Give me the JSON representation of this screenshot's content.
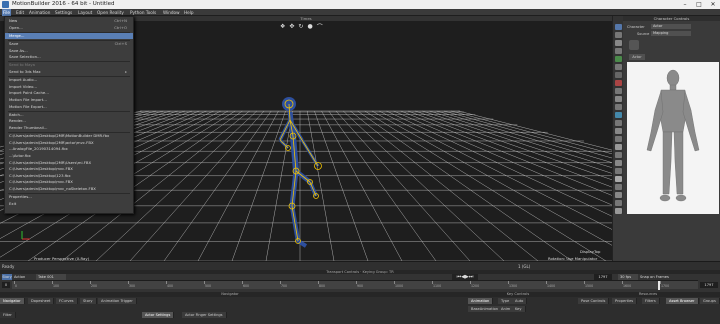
{
  "window": {
    "title": "MotionBuilder 2016 - 64 bit - Untitled"
  },
  "menubar": [
    "File",
    "Edit",
    "Animation",
    "Settings",
    "Layout",
    "Open Reality",
    "Python Tools",
    "Window",
    "Help"
  ],
  "viewport": {
    "times_label": "Times",
    "producer_label": "Producer Perspective (X-Ray)",
    "manipulator_label": "Rotation: Use Manipulator",
    "corner_label": "DisplayTop"
  },
  "file_menu": {
    "items": [
      {
        "label": "New",
        "shortcut": "Ctrl+N",
        "state": "normal"
      },
      {
        "label": "Open...",
        "shortcut": "Ctrl+O",
        "state": "normal"
      },
      {
        "label": "Merge...",
        "shortcut": "",
        "state": "hover"
      },
      {
        "label": "Save",
        "shortcut": "Ctrl+S",
        "state": "normal"
      },
      {
        "label": "Save As...",
        "shortcut": "",
        "state": "normal"
      },
      {
        "label": "Save Selection...",
        "shortcut": "",
        "state": "normal"
      },
      {
        "label": "Send to Maya",
        "shortcut": "",
        "state": "disabled"
      },
      {
        "label": "Send to 3ds Max",
        "shortcut": "",
        "state": "normal"
      },
      {
        "label": "Import Audio...",
        "shortcut": "",
        "state": "normal"
      },
      {
        "label": "Import Video...",
        "shortcut": "",
        "state": "normal"
      },
      {
        "label": "Import Point Cache...",
        "shortcut": "",
        "state": "normal"
      },
      {
        "label": "Motion File Import...",
        "shortcut": "",
        "state": "normal"
      },
      {
        "label": "Motion File Export...",
        "shortcut": "",
        "state": "normal"
      },
      {
        "label": "Batch...",
        "shortcut": "",
        "state": "normal"
      },
      {
        "label": "Render...",
        "shortcut": "",
        "state": "normal"
      },
      {
        "label": "Render Thumbnail...",
        "shortcut": "",
        "state": "normal"
      },
      {
        "label": "C:\\Users\\admin\\Desktop\\2MR\\MotionBuilder DMR.fbx",
        "shortcut": "",
        "state": "normal"
      },
      {
        "label": "C:\\Users\\admin\\Desktop\\2MR\\actor\\mvc.FBX",
        "shortcut": "",
        "state": "normal"
      },
      {
        "label": "...AnalogFile_20190314094.fbx",
        "shortcut": "",
        "state": "normal"
      },
      {
        "label": "...\\Actor.fbx",
        "shortcut": "",
        "state": "normal"
      },
      {
        "label": "C:\\Users\\admin\\Desktop\\2MR\\Users\\mi.FBX",
        "shortcut": "",
        "state": "normal"
      },
      {
        "label": "C:\\Users\\admin\\Desktop\\mvc.FBX",
        "shortcut": "",
        "state": "normal"
      },
      {
        "label": "C:\\Users\\admin\\Desktop\\123.fbx",
        "shortcut": "",
        "state": "normal"
      },
      {
        "label": "C:\\Users\\admin\\Desktop\\mvc.FBX",
        "shortcut": "",
        "state": "normal"
      },
      {
        "label": "C:\\Users\\admin\\Desktop\\mvc_noSkeleton.FBX",
        "shortcut": "",
        "state": "normal"
      },
      {
        "label": "Properties...",
        "shortcut": "",
        "state": "normal"
      },
      {
        "label": "Exit",
        "shortcut": "",
        "state": "normal"
      }
    ],
    "submenu_arrow": "▸"
  },
  "character_controls": {
    "header": "Character Controls",
    "character_label": "Character",
    "character_value": "Actor",
    "source_label": "Source",
    "source_value": "Mapping",
    "tab": "Actor"
  },
  "status": {
    "left": "Ready",
    "right": "1 (GL)"
  },
  "transport": {
    "header": "Transport Controls · Keying Group: TR",
    "mode_label": "Story",
    "action_label": "Action",
    "take": "Take 001",
    "fps": "30 fps",
    "loop": "Snap on Frames",
    "frame_start": "0",
    "frame_end": "1797",
    "current_frame": "1797"
  },
  "timeline_ticks": [
    "0",
    "100",
    "200",
    "300",
    "400",
    "500",
    "600",
    "700",
    "800",
    "900",
    "1000",
    "1100",
    "1200",
    "1300",
    "1400",
    "1500",
    "1600",
    "1700"
  ],
  "bottom_panels": {
    "navigator_header": "Navigator",
    "navigator_tabs": [
      "Navigator",
      "Dopesheet",
      "FCurves",
      "Story",
      "Animation Trigger"
    ],
    "navigator_subtabs": [
      "Actor Settings",
      "Actor Finger Settings"
    ],
    "filter_label": "Filter",
    "keycontrols_header": "Key Controls",
    "keycontrols_tabs": [
      "Animation",
      "Type",
      "Auto"
    ],
    "keycontrols_values": [
      "BaseAnimation",
      "Anim",
      "Key"
    ],
    "resources_header": "Resources",
    "resources_tabs": [
      "Pose Controls",
      "Properties",
      "Filters",
      "Asset Browser",
      "Groups"
    ]
  }
}
